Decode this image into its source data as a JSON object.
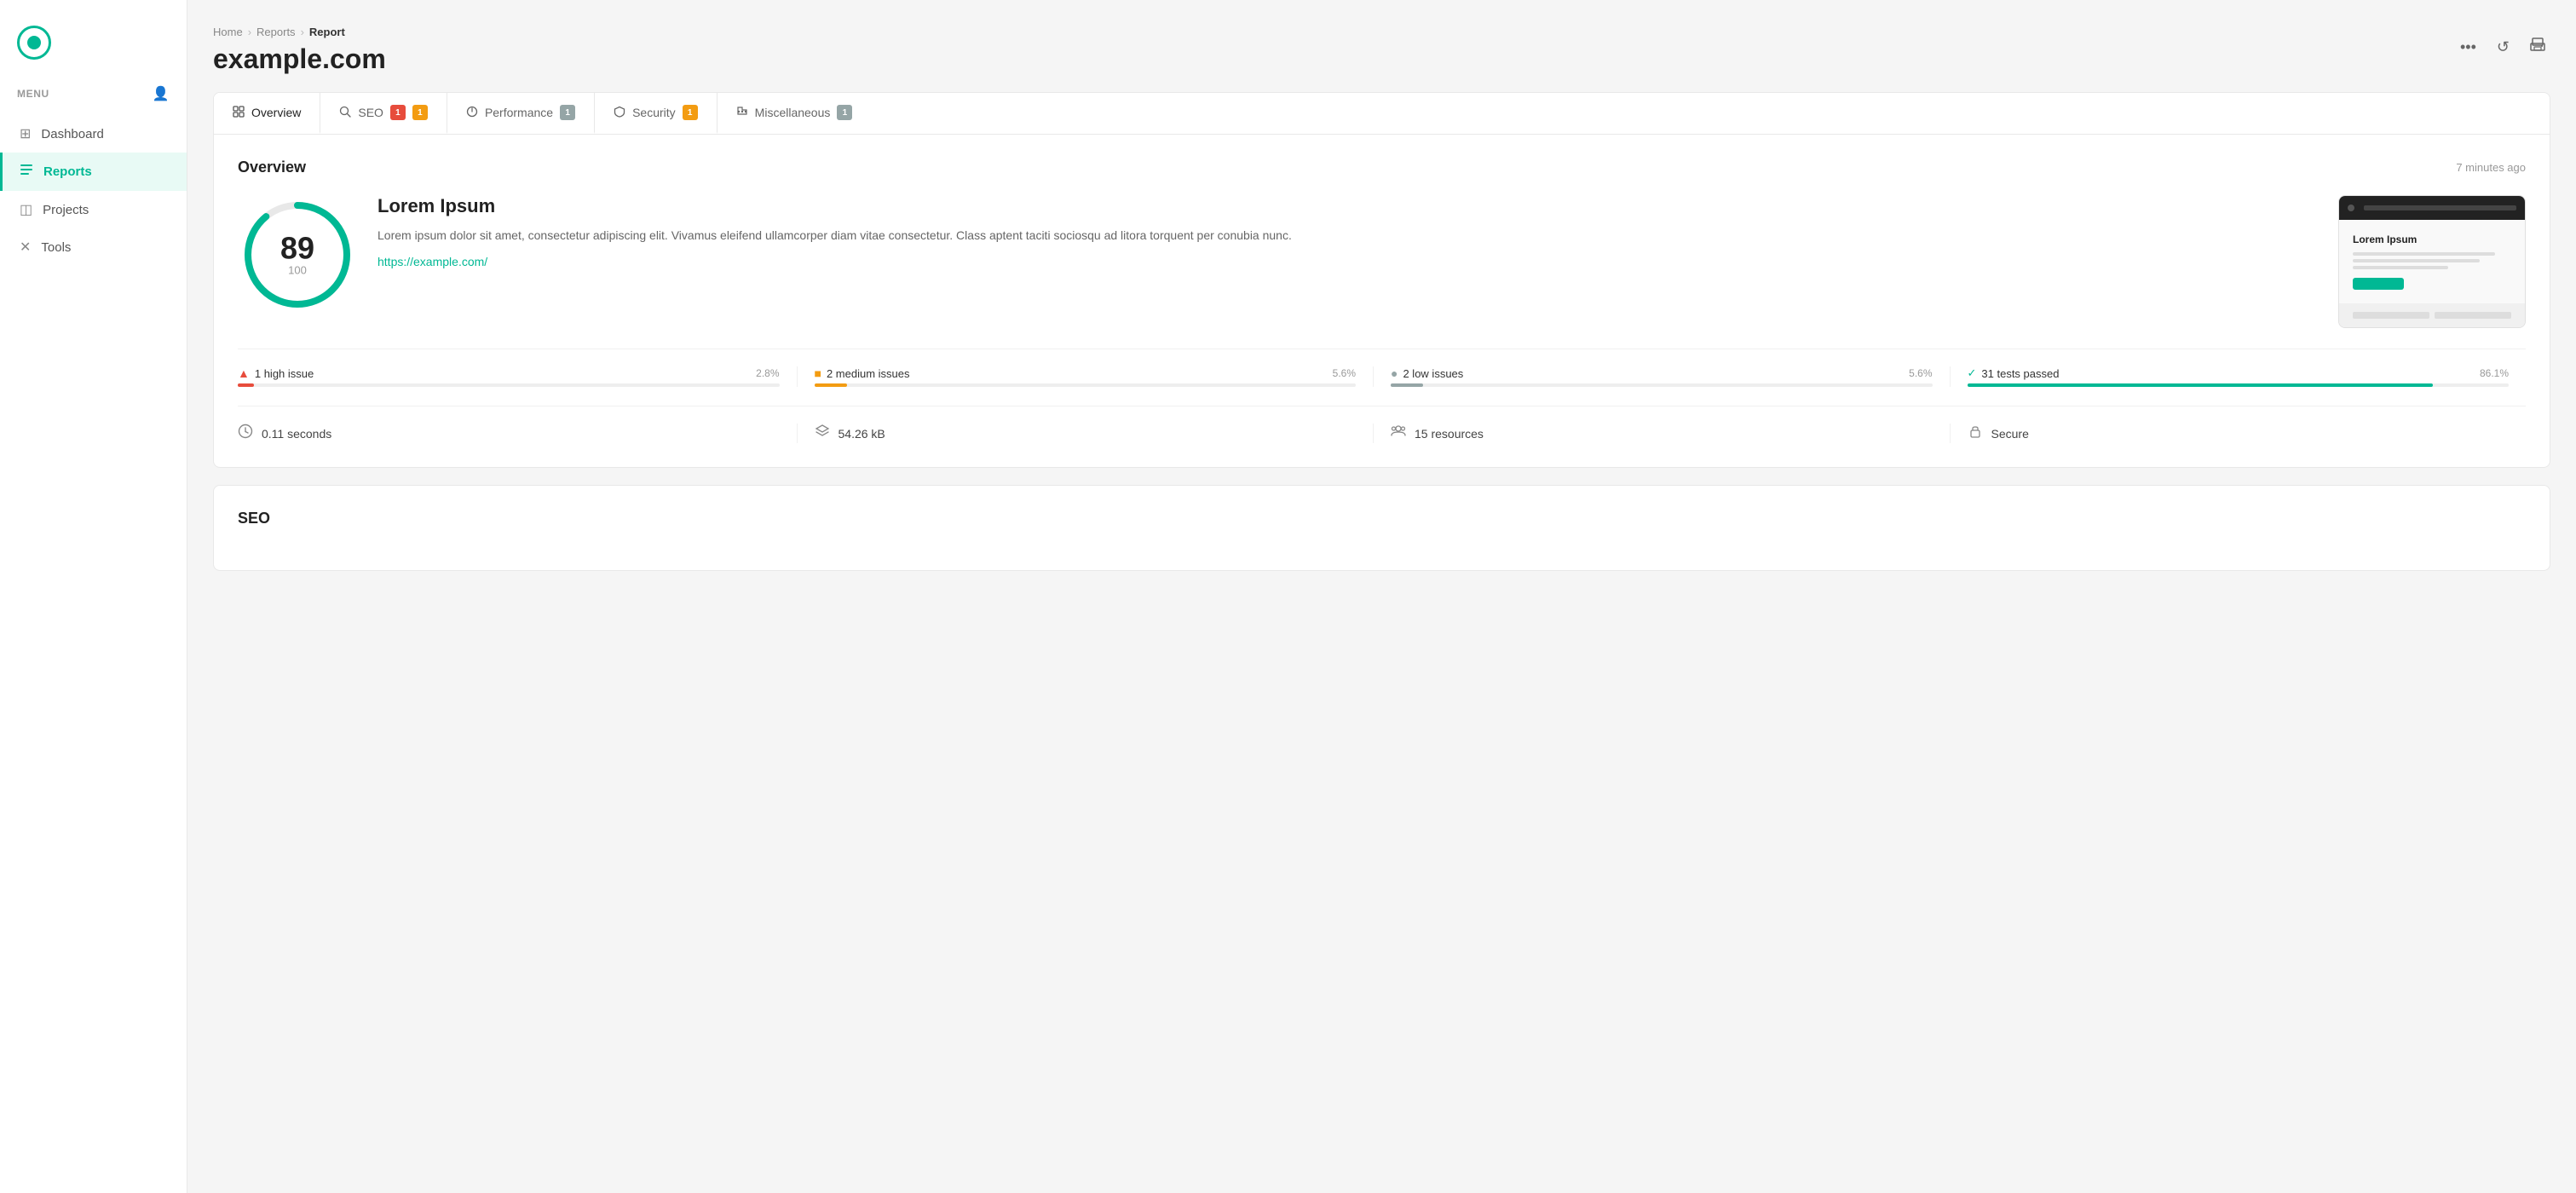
{
  "app": {
    "logo_alt": "App Logo"
  },
  "sidebar": {
    "menu_label": "MENU",
    "account_icon": "👤",
    "items": [
      {
        "id": "dashboard",
        "label": "Dashboard",
        "icon": "⊞",
        "active": false
      },
      {
        "id": "reports",
        "label": "Reports",
        "icon": "☰",
        "active": true
      },
      {
        "id": "projects",
        "label": "Projects",
        "icon": "◫",
        "active": false
      },
      {
        "id": "tools",
        "label": "Tools",
        "icon": "✕",
        "active": false
      }
    ]
  },
  "breadcrumb": {
    "home": "Home",
    "reports": "Reports",
    "current": "Report"
  },
  "page": {
    "title": "example.com"
  },
  "header_actions": {
    "more_label": "•••",
    "refresh_label": "↺",
    "print_label": "🖨"
  },
  "tabs": [
    {
      "id": "overview",
      "label": "Overview",
      "icon": "☰",
      "badges": [],
      "active": true
    },
    {
      "id": "seo",
      "label": "SEO",
      "icon": "🔍",
      "badges": [
        "red:1",
        "yellow:1"
      ],
      "active": false
    },
    {
      "id": "performance",
      "label": "Performance",
      "icon": "◎",
      "badges": [
        "gray:1"
      ],
      "active": false
    },
    {
      "id": "security",
      "label": "Security",
      "icon": "🛡",
      "badges": [
        "yellow:1"
      ],
      "active": false
    },
    {
      "id": "miscellaneous",
      "label": "Miscellaneous",
      "icon": "⋮",
      "badges": [
        "gray:1"
      ],
      "active": false
    }
  ],
  "overview": {
    "section_title": "Overview",
    "section_time": "7 minutes ago",
    "score": 89,
    "score_max": 100,
    "score_percent": 89,
    "report_title": "Lorem Ipsum",
    "report_desc": "Lorem ipsum dolor sit amet, consectetur adipiscing elit. Vivamus eleifend ullamcorper diam vitae consectetur. Class aptent taciti sociosqu ad litora torquent per conubia nunc.",
    "report_url": "https://example.com/",
    "issues": [
      {
        "id": "high",
        "type": "high",
        "label": "1 high issue",
        "pct": "2.8%",
        "fill_width": 3,
        "color": "#e74c3c"
      },
      {
        "id": "medium",
        "type": "medium",
        "label": "2 medium issues",
        "pct": "5.6%",
        "fill_width": 6,
        "color": "#f39c12"
      },
      {
        "id": "low",
        "type": "low",
        "label": "2 low issues",
        "pct": "5.6%",
        "fill_width": 6,
        "color": "#95a5a6"
      },
      {
        "id": "passed",
        "type": "passed",
        "label": "31 tests passed",
        "pct": "86.1%",
        "fill_width": 86,
        "color": "#00b894"
      }
    ],
    "stats": [
      {
        "id": "time",
        "icon": "⏱",
        "label": "0.11 seconds"
      },
      {
        "id": "size",
        "icon": "⚖",
        "label": "54.26 kB"
      },
      {
        "id": "resources",
        "icon": "👥",
        "label": "15 resources"
      },
      {
        "id": "secure",
        "icon": "🔒",
        "label": "Secure"
      }
    ]
  },
  "seo_section": {
    "title": "SEO"
  },
  "preview": {
    "title": "Lorem Ipsum"
  }
}
